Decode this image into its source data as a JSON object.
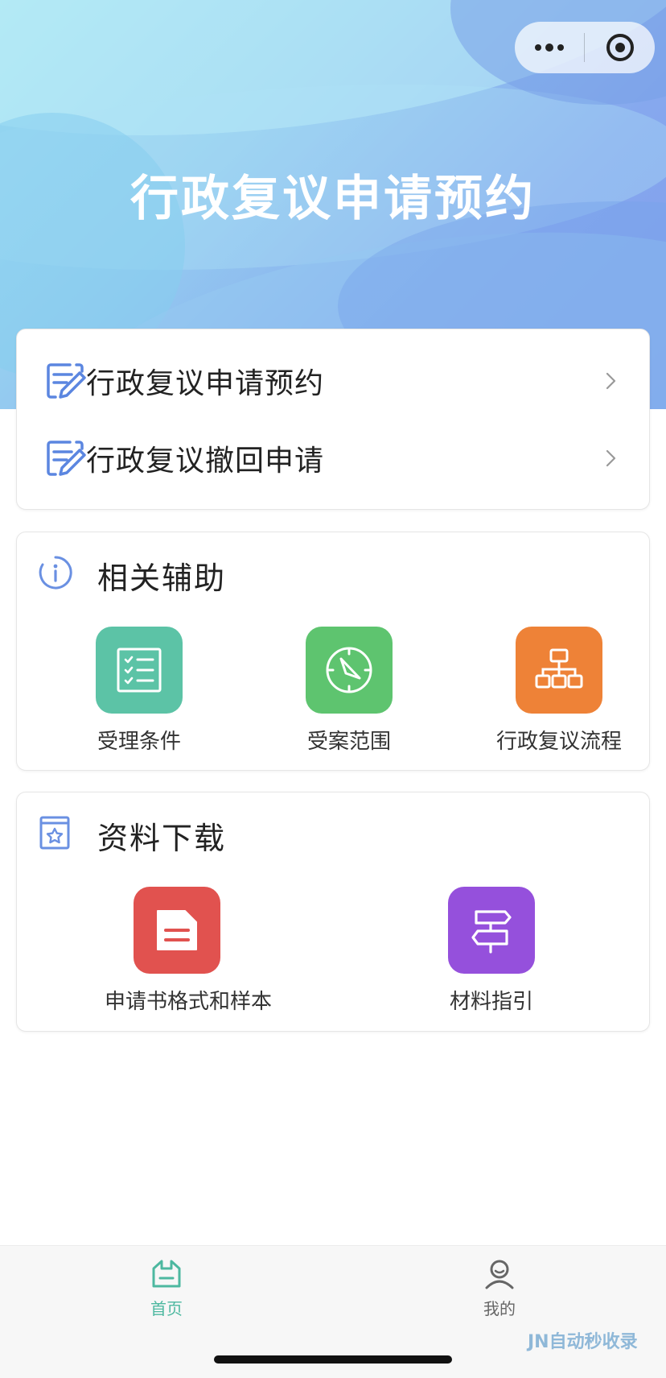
{
  "header": {
    "title": "行政复议申请预约",
    "capsule": {
      "more_icon": "more-dots-icon",
      "close_icon": "target-close-icon"
    }
  },
  "menu": {
    "items": [
      {
        "label": "行政复议申请预约",
        "icon": "edit-document-icon"
      },
      {
        "label": "行政复议撤回申请",
        "icon": "edit-document-icon"
      }
    ]
  },
  "assist": {
    "title": "相关辅助",
    "icon": "info-icon",
    "items": [
      {
        "label": "受理条件",
        "icon": "checklist-icon",
        "color": "#5cc3a6"
      },
      {
        "label": "受案范围",
        "icon": "compass-icon",
        "color": "#5ec46f"
      },
      {
        "label": "行政复议流程",
        "icon": "org-chart-icon",
        "color": "#ee8237"
      }
    ]
  },
  "downloads": {
    "title": "资料下载",
    "icon": "starred-book-icon",
    "items": [
      {
        "label": "申请书格式和样本",
        "icon": "file-icon",
        "color": "#e1524f"
      },
      {
        "label": "材料指引",
        "icon": "signpost-icon",
        "color": "#9550dc"
      }
    ]
  },
  "tabbar": {
    "tabs": [
      {
        "label": "首页",
        "icon": "home-icon",
        "active": true,
        "color": "#4db8a0"
      },
      {
        "label": "我的",
        "icon": "user-icon",
        "active": false,
        "color": "#666666"
      }
    ]
  },
  "watermark": "JN自动秒收录"
}
